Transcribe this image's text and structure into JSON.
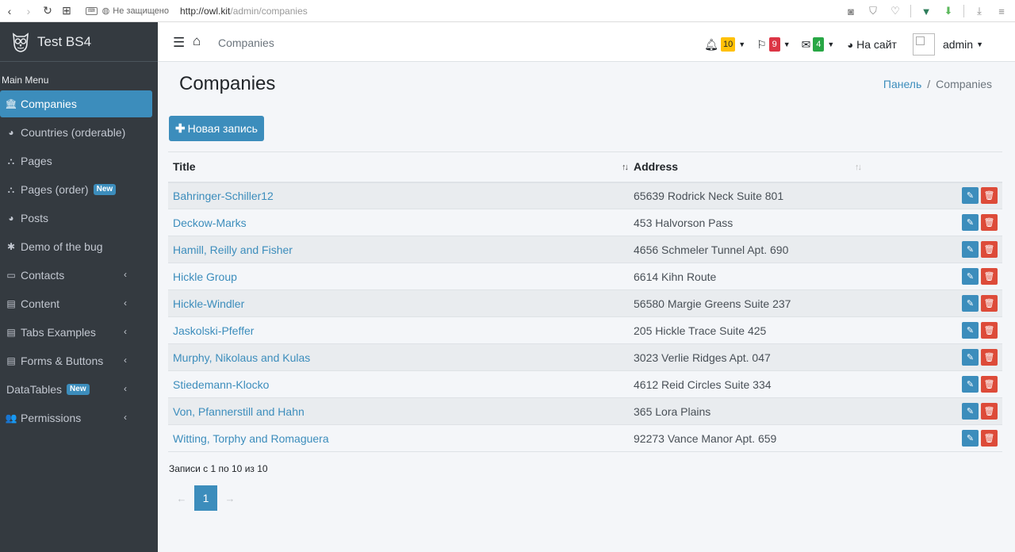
{
  "browser": {
    "security_text": "Не защищено",
    "url_host": "http://owl.kit",
    "url_path": "/admin/companies",
    "icons": [
      "back-icon",
      "forward-icon",
      "reload-icon",
      "apps-icon",
      "camera-icon",
      "shield-icon",
      "heart-icon",
      "vue-icon",
      "download-ext-icon",
      "download-icon"
    ]
  },
  "sidebar": {
    "brand": "Test BS4",
    "menu_header": "Main Menu",
    "new_badge": "New",
    "items": [
      {
        "label": "Companies",
        "icon": "bank-icon"
      },
      {
        "label": "Countries (orderable)",
        "icon": "globe-icon"
      },
      {
        "label": "Pages",
        "icon": "sitemap-icon"
      },
      {
        "label": "Pages (order)",
        "icon": "sitemap-icon"
      },
      {
        "label": "Posts",
        "icon": "globe-icon"
      },
      {
        "label": "Demo of the bug",
        "icon": "bug-icon"
      },
      {
        "label": "Contacts",
        "icon": "card-icon"
      },
      {
        "label": "Content",
        "icon": "newspaper-icon"
      },
      {
        "label": "Tabs Examples",
        "icon": "newspaper-icon"
      },
      {
        "label": "Forms & Buttons",
        "icon": "newspaper-icon"
      },
      {
        "label": "DataTables",
        "icon": ""
      },
      {
        "label": "Permissions",
        "icon": "users-icon"
      }
    ]
  },
  "navbar": {
    "crumb": "Companies",
    "notifications_count": "10",
    "flags_count": "9",
    "messages_count": "4",
    "site_link": "На сайт",
    "user": "admin"
  },
  "page": {
    "title": "Companies",
    "breadcrumb_home": "Панель",
    "breadcrumb_current": "Companies",
    "new_button": "Новая запись",
    "col_title": "Title",
    "col_address": "Address",
    "records_info": "Записи с 1 по 10 из 10",
    "pager_prev": "←",
    "pager_page": "1",
    "pager_next": "→"
  },
  "rows": [
    {
      "title": "Bahringer-Schiller12",
      "address": "65639 Rodrick Neck Suite 801"
    },
    {
      "title": "Deckow-Marks",
      "address": "453 Halvorson Pass"
    },
    {
      "title": "Hamill, Reilly and Fisher",
      "address": "4656 Schmeler Tunnel Apt. 690"
    },
    {
      "title": "Hickle Group",
      "address": "6614 Kihn Route"
    },
    {
      "title": "Hickle-Windler",
      "address": "56580 Margie Greens Suite 237"
    },
    {
      "title": "Jaskolski-Pfeffer",
      "address": "205 Hickle Trace Suite 425"
    },
    {
      "title": "Murphy, Nikolaus and Kulas",
      "address": "3023 Verlie Ridges Apt. 047"
    },
    {
      "title": "Stiedemann-Klocko",
      "address": "4612 Reid Circles Suite 334"
    },
    {
      "title": "Von, Pfannerstill and Hahn",
      "address": "365 Lora Plains"
    },
    {
      "title": "Witting, Torphy and Romaguera",
      "address": "92273 Vance Manor Apt. 659"
    }
  ],
  "colors": {
    "sidebar_bg": "#343a40",
    "accent": "#3c8dbc",
    "danger": "#dd4b39",
    "warning": "#ffc107",
    "success": "#28a745"
  }
}
